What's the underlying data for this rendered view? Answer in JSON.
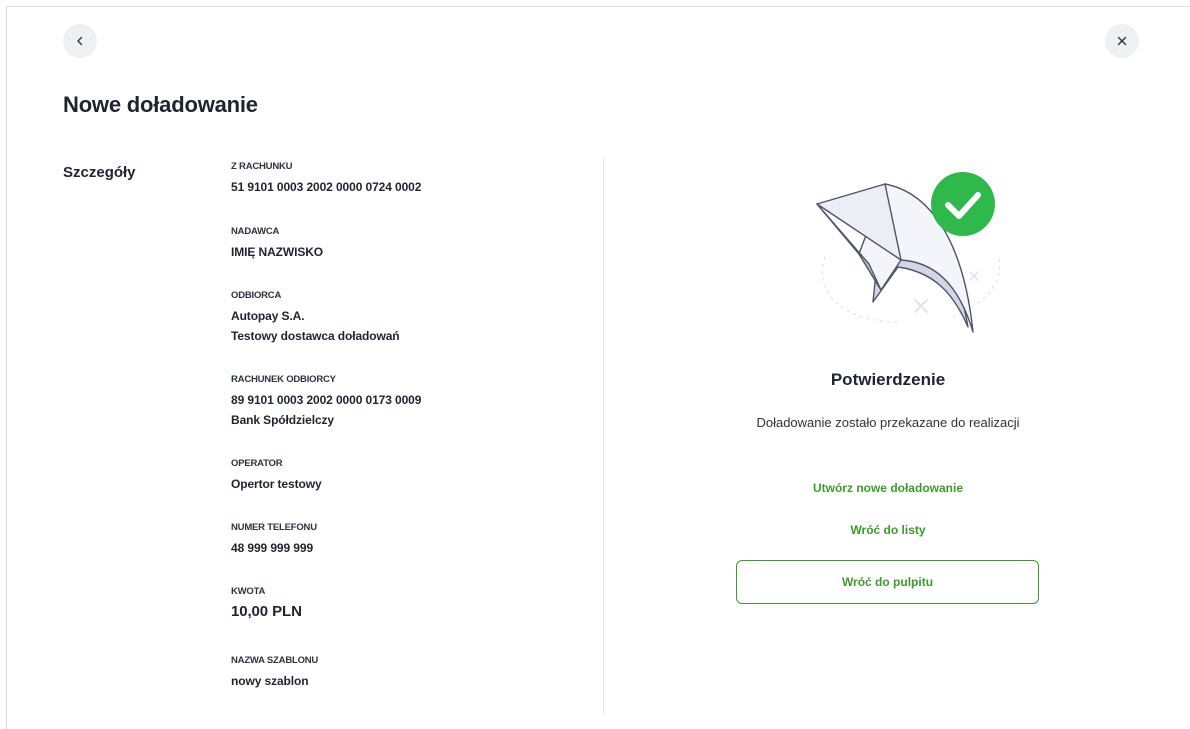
{
  "header": {
    "back_icon": "chevron-left-icon",
    "close_icon": "close-icon",
    "title": "Nowe doładowanie"
  },
  "details": {
    "section_label": "Szczegóły",
    "fields": [
      {
        "label": "Z RACHUNKU",
        "values": [
          "51 9101 0003 2002 0000 0724 0002"
        ]
      },
      {
        "label": "NADAWCA",
        "values": [
          "IMIĘ NAZWISKO"
        ]
      },
      {
        "label": "ODBIORCA",
        "values": [
          "Autopay S.A.",
          "Testowy dostawca doładowań"
        ]
      },
      {
        "label": "RACHUNEK ODBIORCY",
        "values": [
          "89 9101 0003 2002 0000 0173 0009",
          "Bank Spółdzielczy"
        ]
      },
      {
        "label": "OPERATOR",
        "values": [
          "Opertor testowy"
        ]
      },
      {
        "label": "NUMER TELEFONU",
        "values": [
          "48 999 999 999"
        ]
      },
      {
        "label": "KWOTA",
        "values": [
          "10,00 PLN"
        ]
      },
      {
        "label": "NAZWA SZABLONU",
        "values": [
          "nowy szablon"
        ]
      }
    ]
  },
  "confirmation": {
    "illustration_icon": "arrow-success-icon",
    "title": "Potwierdzenie",
    "message": "Doładowanie zostało przekazane do realizacji",
    "new_topup_label": "Utwórz nowe doładowanie",
    "back_to_list_label": "Wróć do listy",
    "back_to_dashboard_label": "Wróć do pulpitu"
  },
  "colors": {
    "accent": "#3c9b2a",
    "success": "#2eb94a",
    "text": "#1c2530"
  }
}
